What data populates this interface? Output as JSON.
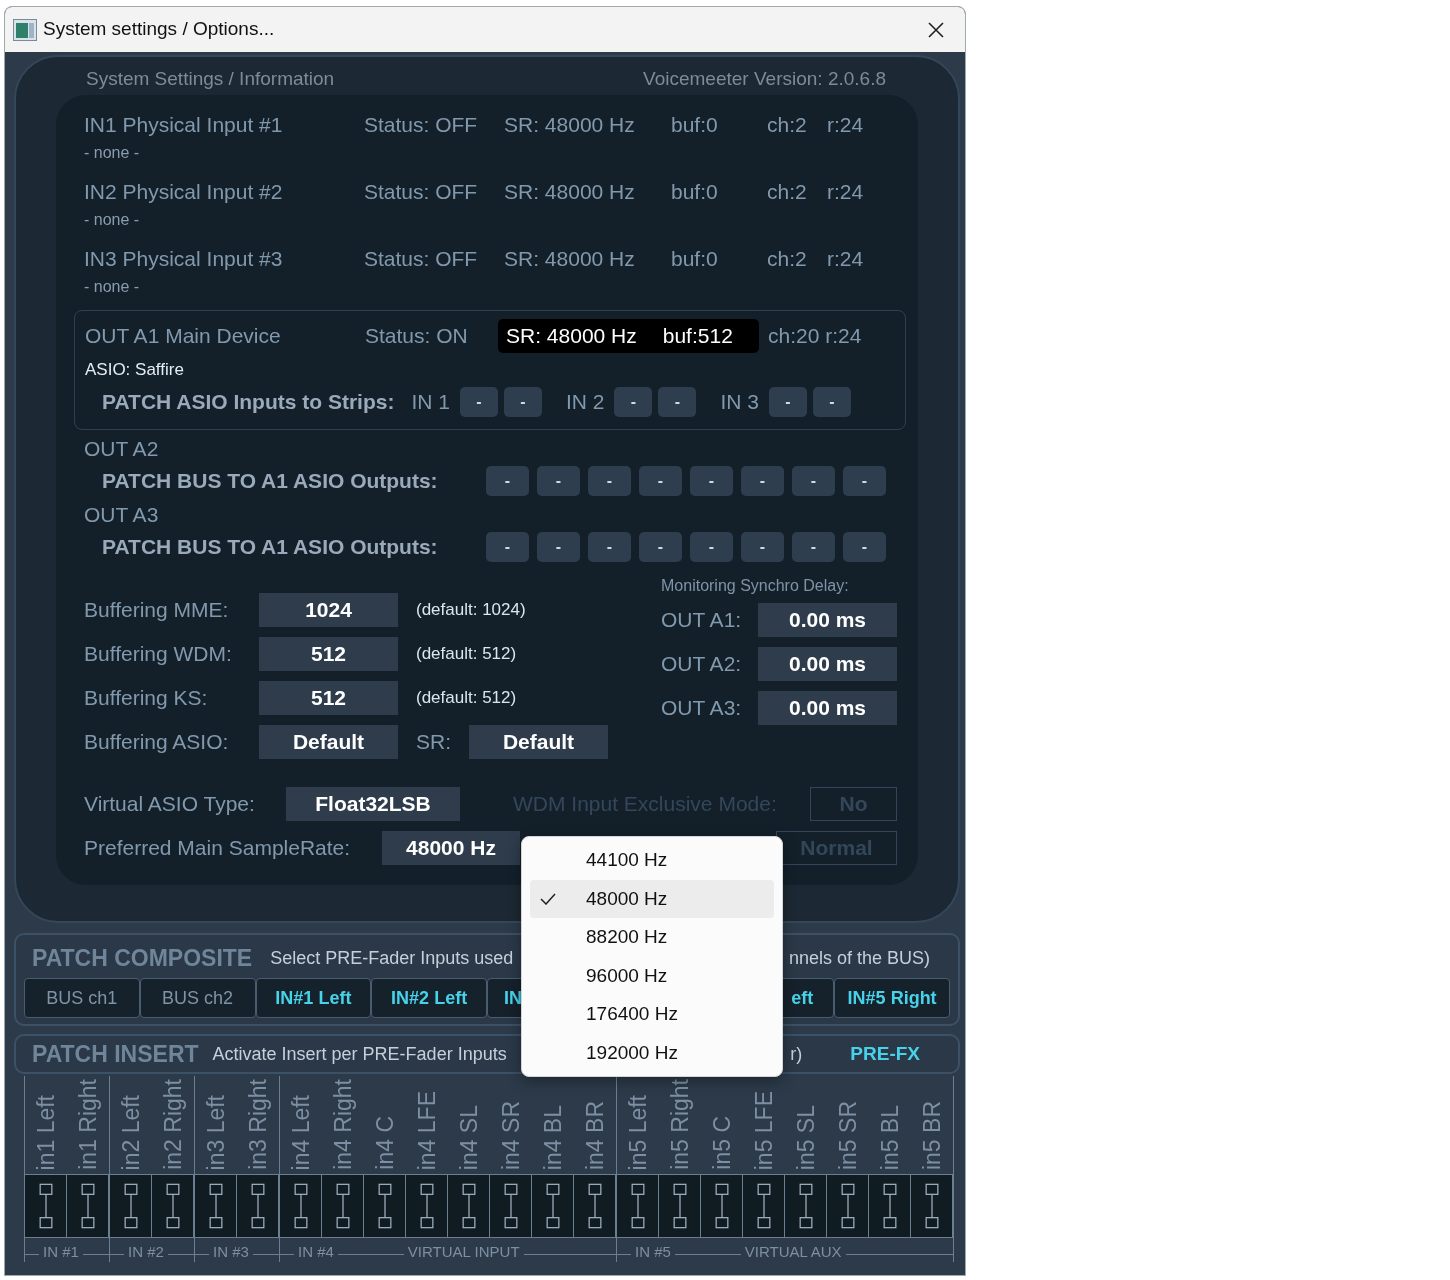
{
  "window": {
    "title": "System settings / Options..."
  },
  "header": {
    "title": "System Settings / Information",
    "version": "Voicemeeter Version: 2.0.6.8"
  },
  "inputs": [
    {
      "name": "IN1 Physical Input #1",
      "device": "- none -",
      "status": "Status: OFF",
      "sr": "SR: 48000 Hz",
      "buf": "buf:0",
      "ch": "ch:2",
      "r": "r:24"
    },
    {
      "name": "IN2 Physical Input #2",
      "device": "- none -",
      "status": "Status: OFF",
      "sr": "SR: 48000 Hz",
      "buf": "buf:0",
      "ch": "ch:2",
      "r": "r:24"
    },
    {
      "name": "IN3 Physical Input #3",
      "device": "- none -",
      "status": "Status: OFF",
      "sr": "SR: 48000 Hz",
      "buf": "buf:0",
      "ch": "ch:2",
      "r": "r:24"
    }
  ],
  "out_a1": {
    "name": "OUT A1 Main Device",
    "status": "Status: ON",
    "sr": "SR: 48000 Hz",
    "buf": "buf:512",
    "ch_r": "ch:20 r:24",
    "device": "ASIO: Saffire",
    "patch_label": "PATCH ASIO Inputs to Strips:",
    "patch_groups": [
      {
        "label": "IN 1",
        "buttons": [
          "-",
          "-"
        ]
      },
      {
        "label": "IN 2",
        "buttons": [
          "-",
          "-"
        ]
      },
      {
        "label": "IN 3",
        "buttons": [
          "-",
          "-"
        ]
      }
    ]
  },
  "outputs": [
    {
      "name": "OUT A2",
      "patch_label": "PATCH BUS TO A1 ASIO Outputs:",
      "buttons": [
        "-",
        "-",
        "-",
        "-",
        "-",
        "-",
        "-",
        "-"
      ]
    },
    {
      "name": "OUT A3",
      "patch_label": "PATCH BUS TO A1 ASIO Outputs:",
      "buttons": [
        "-",
        "-",
        "-",
        "-",
        "-",
        "-",
        "-",
        "-"
      ]
    }
  ],
  "buffering": [
    {
      "kind": "note",
      "label": "Buffering MME:",
      "value": "1024",
      "note": "(default: 1024)"
    },
    {
      "kind": "note",
      "label": "Buffering WDM:",
      "value": "512",
      "note": "(default: 512)"
    },
    {
      "kind": "note",
      "label": "Buffering KS:",
      "value": "512",
      "note": "(default: 512)"
    },
    {
      "kind": "sr",
      "label": "Buffering ASIO:",
      "value": "Default",
      "sr_label": "SR:",
      "sr_value": "Default"
    }
  ],
  "sync_delay": {
    "title": "Monitoring Synchro Delay:",
    "rows": [
      {
        "label": "OUT A1:",
        "value": "0.00 ms"
      },
      {
        "label": "OUT A2:",
        "value": "0.00 ms"
      },
      {
        "label": "OUT A3:",
        "value": "0.00 ms"
      }
    ]
  },
  "virtual_asio": {
    "label": "Virtual ASIO Type:",
    "value": "Float32LSB"
  },
  "wdm_exclusive": {
    "label": "WDM Input Exclusive Mode:",
    "value": "No",
    "disabled": true
  },
  "samplerate": {
    "label": "Preferred Main SampleRate:",
    "value": "48000 Hz"
  },
  "mode_field": {
    "value": "Normal",
    "disabled": true
  },
  "samplerate_menu": [
    {
      "label": "44100 Hz",
      "selected": false
    },
    {
      "label": "48000 Hz",
      "selected": true
    },
    {
      "label": "88200 Hz",
      "selected": false
    },
    {
      "label": "96000 Hz",
      "selected": false
    },
    {
      "label": "176400 Hz",
      "selected": false
    },
    {
      "label": "192000 Hz",
      "selected": false
    }
  ],
  "patch_composite": {
    "title": "PATCH COMPOSITE",
    "description": "Select PRE-Fader Inputs used",
    "description_end": "nnels of the BUS)",
    "buttons": [
      {
        "label": "BUS ch1",
        "kind": "bus"
      },
      {
        "label": "BUS ch2",
        "kind": "bus"
      },
      {
        "label": "IN#1 Left",
        "kind": "input"
      },
      {
        "label": "IN#2 Left",
        "kind": "input"
      },
      {
        "label": "IN",
        "kind": "input"
      },
      {
        "label": "eft",
        "kind": "input"
      },
      {
        "label": "IN#5 Right",
        "kind": "input"
      }
    ]
  },
  "patch_insert": {
    "title": "PATCH INSERT",
    "description": "Activate Insert per PRE-Fader Inputs",
    "description_end": "r)",
    "mode": "PRE-FX",
    "groups": [
      {
        "footer": [
          "IN #1"
        ],
        "channels": [
          "in1 Left",
          "in1 Right"
        ]
      },
      {
        "footer": [
          "IN #2"
        ],
        "channels": [
          "in2 Left",
          "in2 Right"
        ]
      },
      {
        "footer": [
          "IN #3"
        ],
        "channels": [
          "in3 Left",
          "in3 Right"
        ]
      },
      {
        "footer": [
          "IN #4",
          "VIRTUAL INPUT"
        ],
        "channels": [
          "in4 Left",
          "in4 Right",
          "in4 C",
          "in4 LFE",
          "in4 SL",
          "in4 SR",
          "in4 BL",
          "in4 BR"
        ]
      },
      {
        "footer": [
          "IN #5",
          "VIRTUAL AUX"
        ],
        "channels": [
          "in5 Left",
          "in5 Right",
          "in5 C",
          "in5 LFE",
          "in5 SL",
          "in5 SR",
          "in5 BL",
          "in5 BR"
        ]
      }
    ]
  }
}
